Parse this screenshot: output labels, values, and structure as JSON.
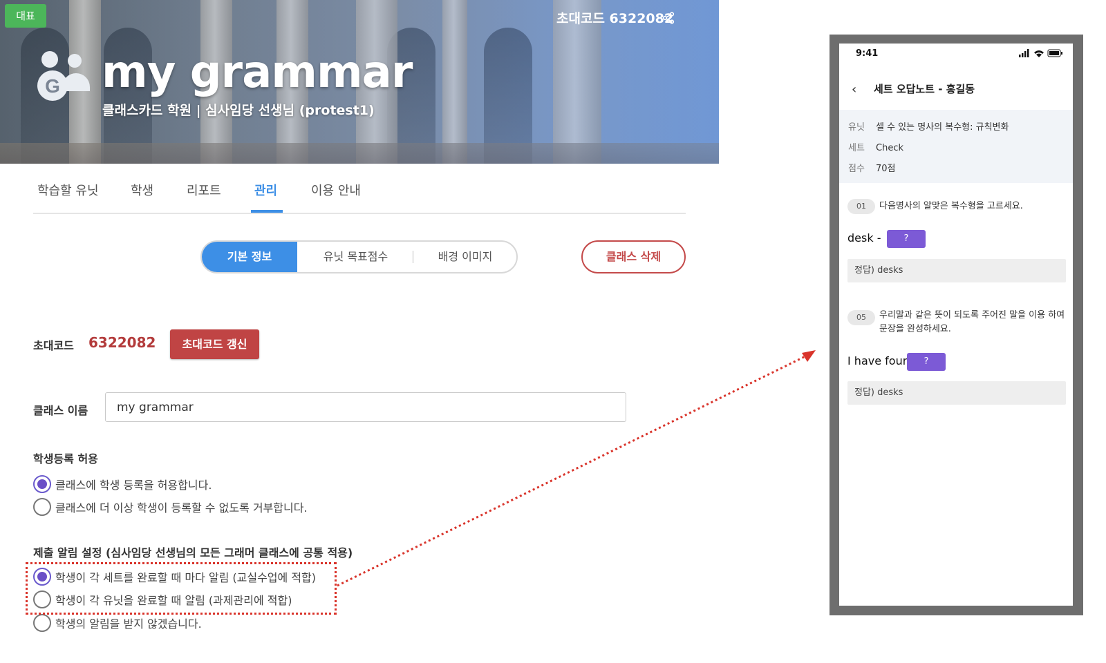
{
  "banner": {
    "badge": "대표",
    "invite_label": "초대코드 6322082",
    "title": "my grammar",
    "subtitle": "클래스카드 학원 | 심사임당 선생님 (protest1)"
  },
  "tabs": [
    {
      "label": "학습할 유닛"
    },
    {
      "label": "학생"
    },
    {
      "label": "리포트"
    },
    {
      "label": "관리"
    },
    {
      "label": "이용 안내"
    }
  ],
  "segments": [
    {
      "label": "기본 정보"
    },
    {
      "label": "유닛 목표점수"
    },
    {
      "label": "배경 이미지"
    }
  ],
  "delete_button": "클래스 삭제",
  "invite": {
    "label": "초대코드",
    "code": "6322082",
    "refresh_button": "초대코드 갱신"
  },
  "class_name": {
    "label": "클래스 이름",
    "value": "my grammar"
  },
  "registration": {
    "heading": "학생등록 허용",
    "options": [
      {
        "label": "클래스에 학생 등록을 허용합니다.",
        "checked": true
      },
      {
        "label": "클래스에 더 이상 학생이 등록할 수 없도록 거부합니다.",
        "checked": false
      }
    ]
  },
  "notification": {
    "heading": "제출 알림 설정 (심사임당 선생님의 모든 그래머 클래스에 공통 적용)",
    "options": [
      {
        "label": "학생이 각 세트를 완료할 때 마다 알림 (교실수업에 적합)",
        "checked": true
      },
      {
        "label": "학생이 각 유닛을 완료할 때 알림 (과제관리에 적합)",
        "checked": false
      },
      {
        "label": "학생의 알림을 받지 않겠습니다.",
        "checked": false
      }
    ]
  },
  "phone": {
    "time": "9:41",
    "nav_title": "세트 오답노트 - 홍길동",
    "info": [
      {
        "key": "유닛",
        "value": "셀 수 있는 명사의 복수형: 규칙변화"
      },
      {
        "key": "세트",
        "value": "Check"
      },
      {
        "key": "점수",
        "value": "70점"
      }
    ],
    "questions": [
      {
        "num": "01",
        "text": "다음명사의 알맞은 복수형을 고르세요.",
        "answer_prefix": "desk -",
        "chip": "?",
        "correct": "정답) desks"
      },
      {
        "num": "05",
        "text": "우리말과 같은 뜻이 되도록 주어진 말을 이용 하여 문장을 완성하세요.",
        "answer_prefix": "I have four",
        "chip": "?",
        "correct": "정답) desks"
      }
    ]
  },
  "colors": {
    "accent_blue": "#3d8fe6",
    "danger_red": "#c04444",
    "radio_purple": "#6a4fc7",
    "chip_purple": "#7c5ad6",
    "badge_green": "#4cb65a"
  }
}
